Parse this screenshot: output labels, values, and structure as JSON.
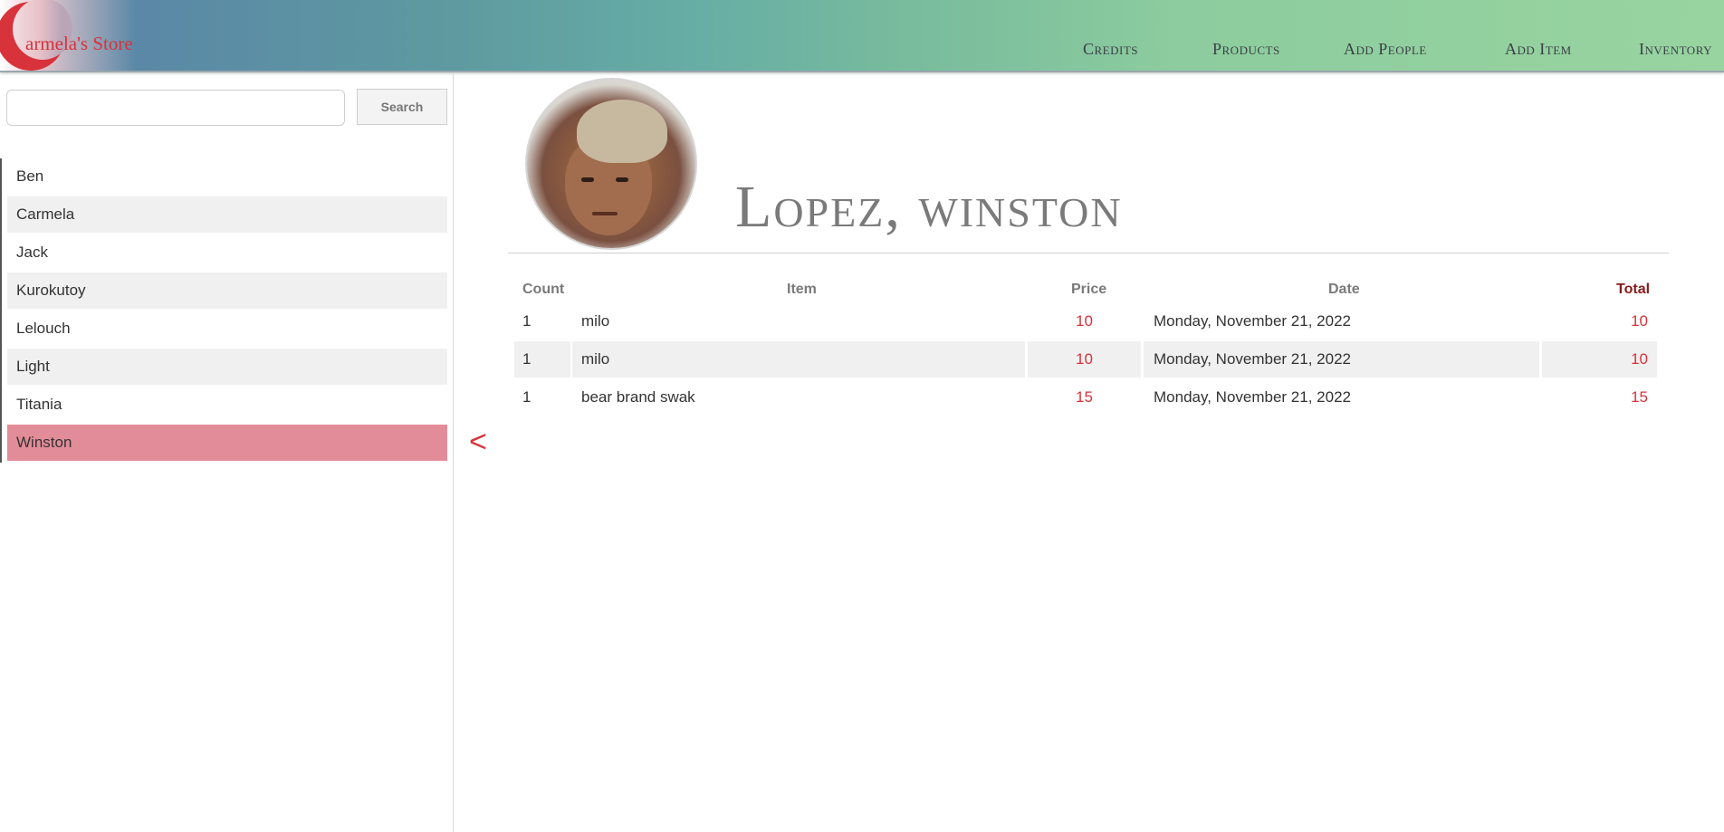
{
  "brand": {
    "logo_text": "armela's Store",
    "logo_letter": "C"
  },
  "nav": {
    "credits": "Credits",
    "products": "Products",
    "add_people": "Add People",
    "add_item": "Add Item",
    "inventory": "Inventory"
  },
  "search": {
    "value": "",
    "placeholder": "",
    "button": "Search"
  },
  "people": [
    {
      "name": "Ben"
    },
    {
      "name": "Carmela"
    },
    {
      "name": "Jack"
    },
    {
      "name": "Kurokutoy"
    },
    {
      "name": "Lelouch"
    },
    {
      "name": "Light"
    },
    {
      "name": "Titania"
    },
    {
      "name": "Winston",
      "active": true
    }
  ],
  "profile": {
    "name": "Lopez, winston"
  },
  "table": {
    "headers": {
      "count": "Count",
      "item": "Item",
      "price": "Price",
      "date": "Date",
      "total": "Total"
    },
    "rows": [
      {
        "count": "1",
        "item": "milo",
        "price": "10",
        "date": "Monday, November 21, 2022",
        "total": "10"
      },
      {
        "count": "1",
        "item": "milo",
        "price": "10",
        "date": "Monday, November 21, 2022",
        "total": "10"
      },
      {
        "count": "1",
        "item": "bear brand swak",
        "price": "15",
        "date": "Monday, November 21, 2022",
        "total": "15"
      }
    ]
  },
  "back": {
    "label": "<"
  },
  "colors": {
    "accent": "#d8323a",
    "active_row": "#e38c99",
    "alt_row": "#f0f0f0"
  }
}
